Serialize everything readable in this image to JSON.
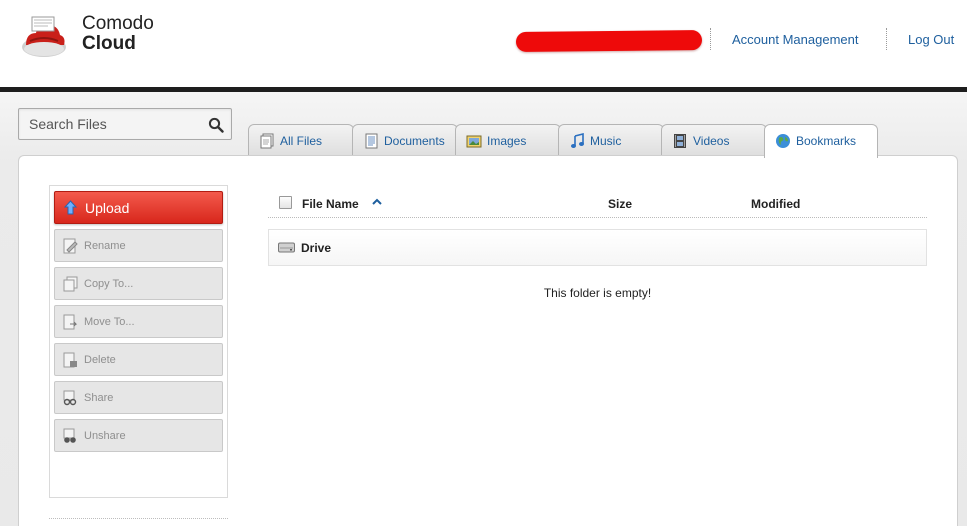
{
  "app": {
    "brand_line1": "Comodo",
    "brand_line2": "Cloud"
  },
  "header": {
    "account_link": "Account Management",
    "logout_link": "Log Out"
  },
  "search": {
    "placeholder": "Search Files",
    "icon": "search-icon"
  },
  "tabs": [
    {
      "label": "All Files",
      "icon": "all-files-icon",
      "active": false
    },
    {
      "label": "Documents",
      "icon": "documents-icon",
      "active": false
    },
    {
      "label": "Images",
      "icon": "images-icon",
      "active": false
    },
    {
      "label": "Music",
      "icon": "music-icon",
      "active": false
    },
    {
      "label": "Videos",
      "icon": "videos-icon",
      "active": false
    },
    {
      "label": "Bookmarks",
      "icon": "globe-icon",
      "active": true
    }
  ],
  "actions": [
    {
      "label": "Upload",
      "icon": "upload-arrow-icon",
      "enabled": true
    },
    {
      "label": "Rename",
      "icon": "rename-icon",
      "enabled": false
    },
    {
      "label": "Copy To...",
      "icon": "copy-icon",
      "enabled": false
    },
    {
      "label": "Move To...",
      "icon": "move-icon",
      "enabled": false
    },
    {
      "label": "Delete",
      "icon": "delete-icon",
      "enabled": false
    },
    {
      "label": "Share",
      "icon": "share-icon",
      "enabled": false
    },
    {
      "label": "Unshare",
      "icon": "unshare-icon",
      "enabled": false
    }
  ],
  "table": {
    "columns": [
      "File Name",
      "Size",
      "Modified"
    ],
    "sort_column": "File Name",
    "sort_direction": "ascending",
    "rows": [
      {
        "name": "Drive",
        "icon": "drive-icon"
      }
    ],
    "empty_message": "This folder is empty!"
  },
  "colors": {
    "link": "#1e5f9e",
    "upload_button": "#e03a2d",
    "redaction": "#ee0a0a",
    "header_bar": "#1e1e1e"
  }
}
